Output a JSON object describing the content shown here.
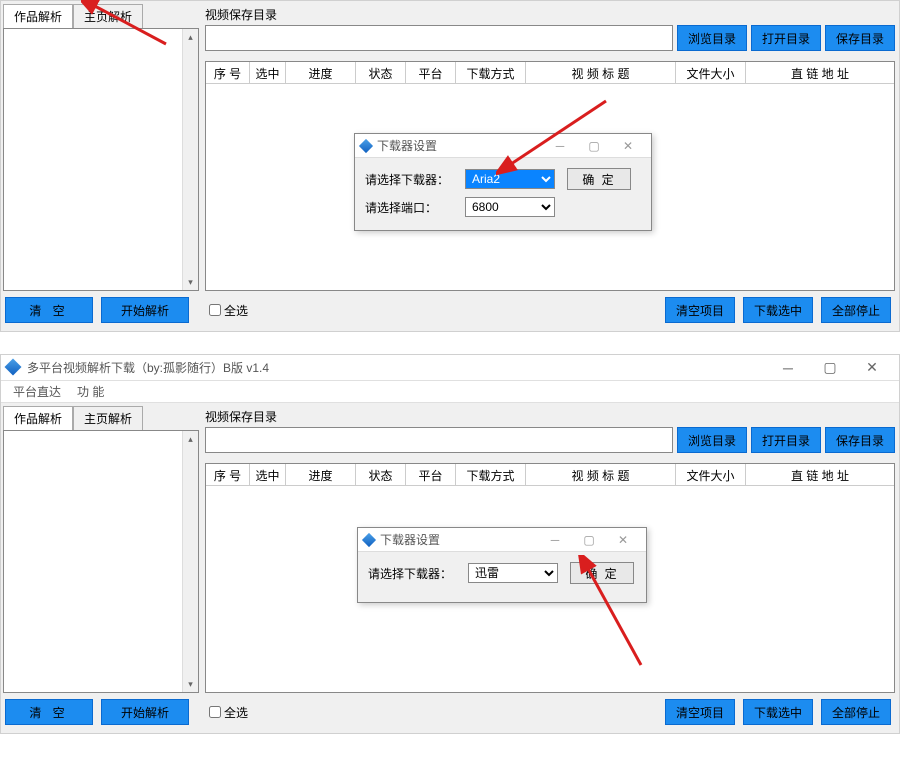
{
  "app_title": "多平台视频解析下载（by:孤影随行）B版 v1.4",
  "menu": {
    "item1": "平台直达",
    "item2": "功 能"
  },
  "tabs": {
    "works": "作品解析",
    "home": "主页解析"
  },
  "save_dir_label": "视频保存目录",
  "buttons": {
    "browse": "浏览目录",
    "open": "打开目录",
    "save": "保存目录",
    "clear": "清 空",
    "start_parse": "开始解析",
    "clear_items": "清空项目",
    "download_selected": "下载选中",
    "stop_all": "全部停止"
  },
  "select_all": "全选",
  "table_headers": [
    "序 号",
    "选中",
    "进度",
    "状态",
    "平台",
    "下载方式",
    "视 频 标 题",
    "文件大小",
    "直 链 地 址"
  ],
  "dialog": {
    "title": "下载器设置",
    "label_downloader": "请选择下载器：",
    "label_port": "请选择端口：",
    "confirm": "确 定"
  },
  "downloaders": {
    "aria2": "Aria2",
    "xunlei": "迅雷"
  },
  "ports": {
    "p6800": "6800"
  }
}
